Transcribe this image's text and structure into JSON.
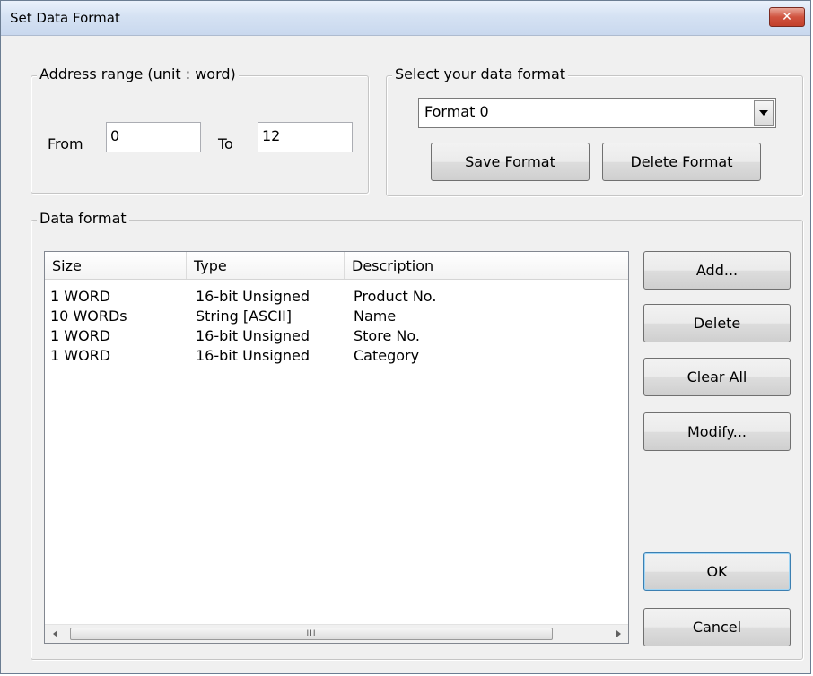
{
  "window": {
    "title": "Set Data Format",
    "close_label": "✕"
  },
  "address_range": {
    "label": "Address range (unit : word)",
    "from_label": "From",
    "from_value": "0",
    "to_label": "To",
    "to_value": "12"
  },
  "format_select": {
    "label": "Select your data format",
    "selected": "Format 0",
    "save_label": "Save Format",
    "delete_label": "Delete Format"
  },
  "data_format": {
    "label": "Data format",
    "columns": [
      "Size",
      "Type",
      "Description"
    ],
    "rows": [
      [
        "1 WORD",
        "16-bit Unsigned",
        "Product No."
      ],
      [
        "10 WORDs",
        "String [ASCII]",
        "Name"
      ],
      [
        "1 WORD",
        "16-bit Unsigned",
        "Store No."
      ],
      [
        "1 WORD",
        "16-bit Unsigned",
        "Category"
      ]
    ],
    "scroll_thumb_grip": "III"
  },
  "actions": {
    "add_label": "Add...",
    "delete_label": "Delete",
    "clear_all_label": "Clear All",
    "modify_label": "Modify...",
    "ok_label": "OK",
    "cancel_label": "Cancel"
  }
}
